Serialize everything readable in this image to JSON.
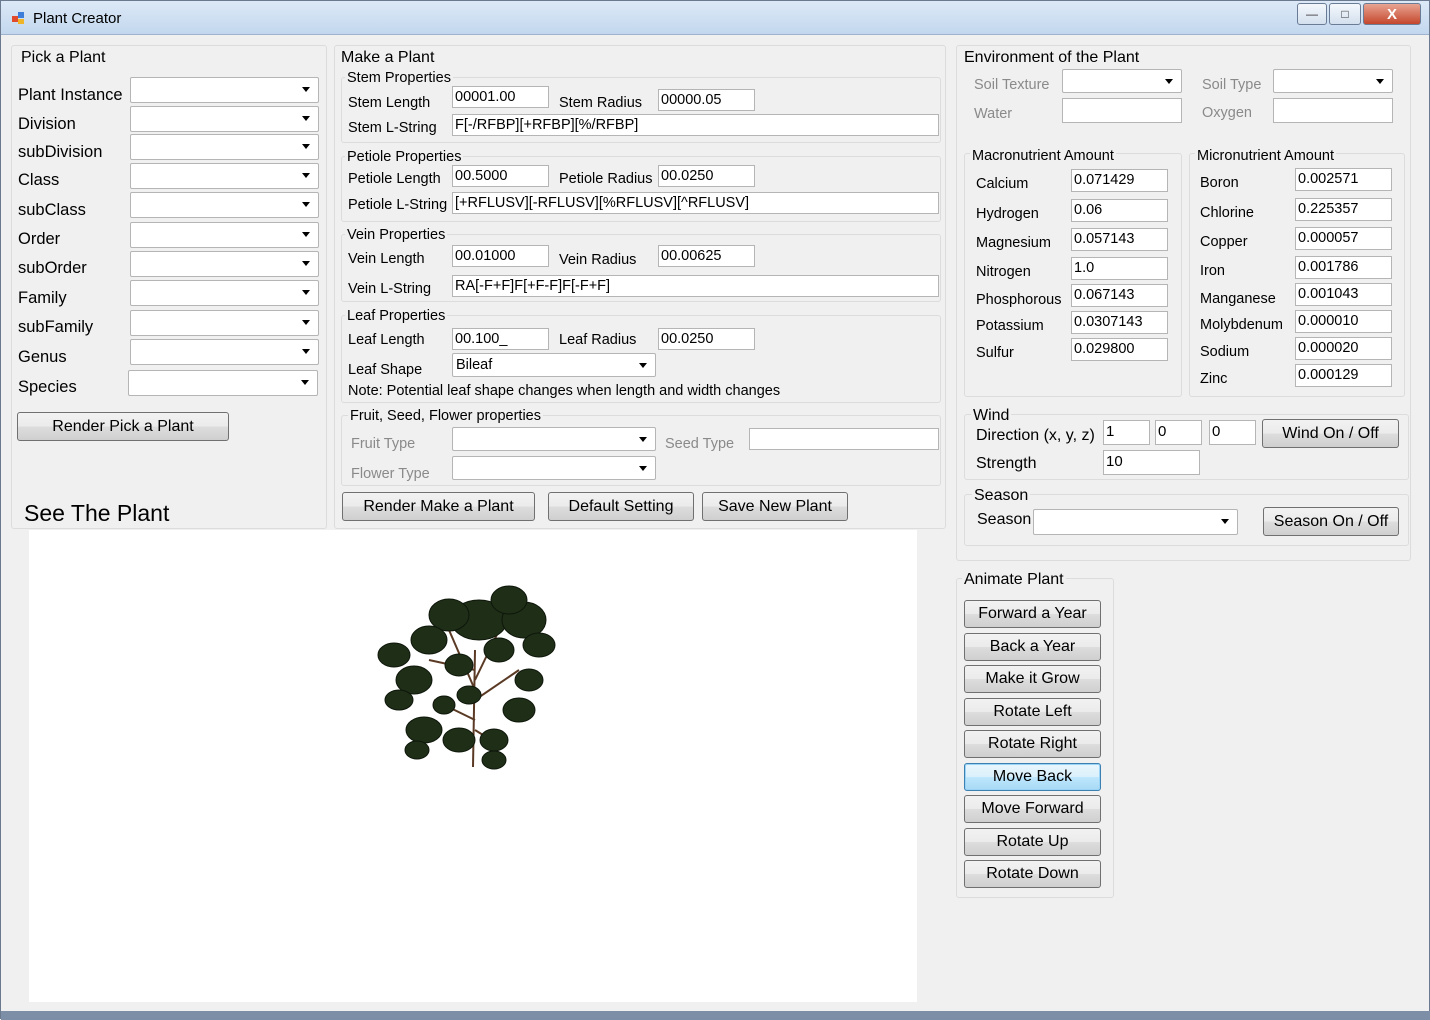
{
  "window": {
    "title": "Plant Creator",
    "minimize": "—",
    "maximize": "□",
    "close": "X"
  },
  "pick": {
    "title": "Pick a Plant",
    "fields": [
      {
        "label": "Plant Instance",
        "value": ""
      },
      {
        "label": "Division",
        "value": ""
      },
      {
        "label": "subDivision",
        "value": ""
      },
      {
        "label": "Class",
        "value": ""
      },
      {
        "label": "subClass",
        "value": ""
      },
      {
        "label": "Order",
        "value": ""
      },
      {
        "label": "subOrder",
        "value": ""
      },
      {
        "label": "Family",
        "value": ""
      },
      {
        "label": "subFamily",
        "value": ""
      },
      {
        "label": "Genus",
        "value": ""
      },
      {
        "label": "Species",
        "value": ""
      }
    ],
    "render_button": "Render Pick a Plant"
  },
  "see": {
    "title": "See The Plant"
  },
  "make": {
    "title": "Make a Plant",
    "stem": {
      "title": "Stem Properties",
      "length_label": "Stem Length",
      "length": "00001.00",
      "radius_label": "Stem Radius",
      "radius": "00000.05",
      "lstring_label": "Stem L-String",
      "lstring": "F[-/RFBP][+RFBP][%/RFBP]"
    },
    "petiole": {
      "title": "Petiole Properties",
      "length_label": "Petiole Length",
      "length": "00.5000",
      "radius_label": "Petiole Radius",
      "radius": "00.0250",
      "lstring_label": "Petiole L-String",
      "lstring": "[+RFLUSV][-RFLUSV][%RFLUSV][^RFLUSV]"
    },
    "vein": {
      "title": "Vein Properties",
      "length_label": "Vein Length",
      "length": "00.01000",
      "radius_label": "Vein Radius",
      "radius": "00.00625",
      "lstring_label": "Vein L-String",
      "lstring": "RA[-F+F]F[+F-F]F[-F+F]"
    },
    "leaf": {
      "title": "Leaf Properties",
      "length_label": "Leaf Length",
      "length": "00.100_",
      "radius_label": "Leaf Radius",
      "radius": "00.0250",
      "shape_label": "Leaf Shape",
      "shape": "Bileaf",
      "note": "Note: Potential leaf shape changes when length and width changes"
    },
    "fruit": {
      "title": "Fruit, Seed, Flower properties",
      "fruit_label": "Fruit Type",
      "fruit": "",
      "seed_label": "Seed Type",
      "seed": "",
      "flower_label": "Flower Type",
      "flower": ""
    },
    "buttons": {
      "render": "Render Make a Plant",
      "default": "Default Setting",
      "save": "Save New Plant"
    }
  },
  "env": {
    "title": "Environment of the Plant",
    "soil_texture_label": "Soil Texture",
    "soil_texture": "",
    "soil_type_label": "Soil Type",
    "soil_type": "",
    "water_label": "Water",
    "water": "",
    "oxygen_label": "Oxygen",
    "oxygen": "",
    "macro": {
      "title": "Macronutrient Amount",
      "items": [
        {
          "label": "Calcium",
          "value": "0.071429"
        },
        {
          "label": "Hydrogen",
          "value": "0.06"
        },
        {
          "label": "Magnesium",
          "value": "0.057143"
        },
        {
          "label": "Nitrogen",
          "value": "1.0"
        },
        {
          "label": "Phosphorous",
          "value": "0.067143"
        },
        {
          "label": "Potassium",
          "value": "0.0307143"
        },
        {
          "label": "Sulfur",
          "value": "0.029800"
        }
      ]
    },
    "micro": {
      "title": "Micronutrient Amount",
      "items": [
        {
          "label": "Boron",
          "value": "0.002571"
        },
        {
          "label": "Chlorine",
          "value": "0.225357"
        },
        {
          "label": "Copper",
          "value": "0.000057"
        },
        {
          "label": "Iron",
          "value": "0.001786"
        },
        {
          "label": "Manganese",
          "value": "0.001043"
        },
        {
          "label": "Molybdenum",
          "value": "0.000010"
        },
        {
          "label": "Sodium",
          "value": "0.000020"
        },
        {
          "label": "Zinc",
          "value": "0.000129"
        }
      ]
    },
    "wind": {
      "title": "Wind",
      "direction_label": "Direction (x, y, z)",
      "x": "1",
      "y": "0",
      "z": "0",
      "toggle": "Wind On / Off",
      "strength_label": "Strength",
      "strength": "10"
    },
    "season": {
      "title": "Season",
      "label": "Season",
      "value": "",
      "toggle": "Season On / Off"
    }
  },
  "animate": {
    "title": "Animate Plant",
    "buttons": [
      "Forward a Year",
      "Back a Year",
      "Make it Grow",
      "Rotate Left",
      "Rotate Right",
      "Move Back",
      "Move Forward",
      "Rotate Up",
      "Rotate Down"
    ]
  }
}
